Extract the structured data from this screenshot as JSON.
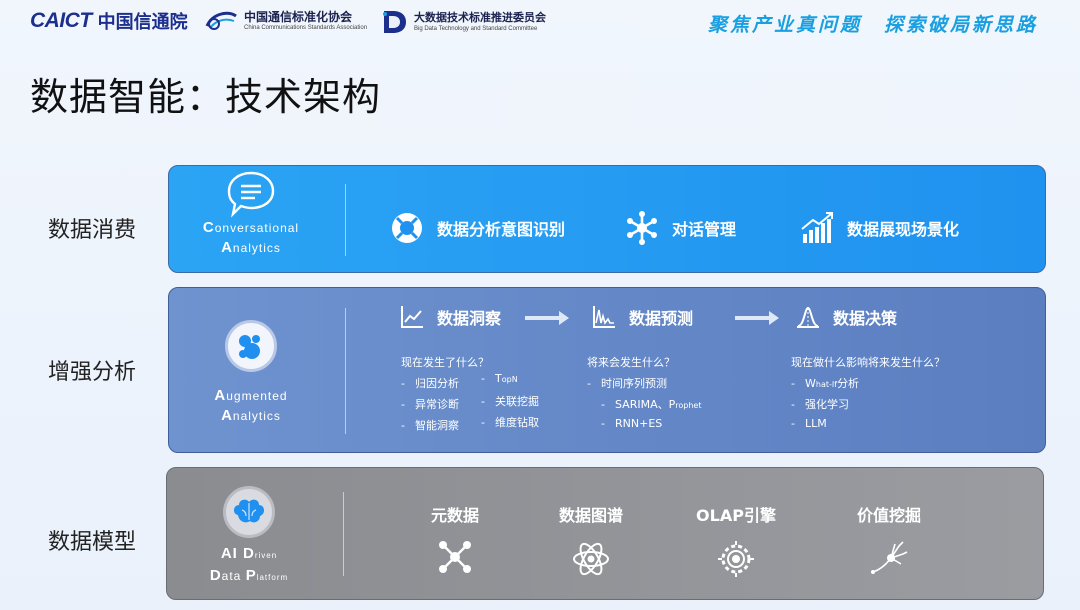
{
  "header": {
    "caict_mark": "CAICT",
    "caict_cn": "中国信通院",
    "ccsa_cn": "中国通信标准化协会",
    "ccsa_en": "China Communications Standards Association",
    "bdtc_cn": "大数据技术标准推进委员会",
    "bdtc_en": "Big Data Technology and Standard Committee",
    "slogan_1": "聚焦产业真问题",
    "slogan_2": "探索破局新思路"
  },
  "title": "数据智能：技术架构",
  "rows": {
    "consume": {
      "label": "数据消费",
      "caption_1_first": "C",
      "caption_1_rest": "onversational",
      "caption_2_first": "A",
      "caption_2_rest": "nalytics",
      "features": [
        {
          "label": "数据分析意图识别",
          "icon": "lifebuoy-icon"
        },
        {
          "label": "对话管理",
          "icon": "network-hub-icon"
        },
        {
          "label": "数据展现场景化",
          "icon": "bar-chart-icon"
        }
      ]
    },
    "augment": {
      "label": "增强分析",
      "caption_1_first": "A",
      "caption_1_rest": "ugmented",
      "caption_2_first": "A",
      "caption_2_rest": "nalytics",
      "stages": [
        {
          "label": "数据洞察",
          "icon": "line-chart-icon"
        },
        {
          "label": "数据预测",
          "icon": "waveform-icon"
        },
        {
          "label": "数据决策",
          "icon": "bell-curve-icon"
        }
      ],
      "insight": {
        "question": "现在发生了什么？",
        "col1": [
          "归因分析",
          "异常诊断",
          "智能洞察"
        ],
        "col2_topn_first": "T",
        "col2_topn_rest": "opN",
        "col2": [
          "关联挖掘",
          "维度钻取"
        ]
      },
      "predict": {
        "question": "将来会发生什么？",
        "item1": "时间序列预测",
        "sub1_main": "SARIMA、P",
        "sub1_small": "rophet",
        "sub2": "RNN+ES"
      },
      "decide": {
        "question": "现在做什么影响将来发生什么？",
        "item1_first": "W",
        "item1_small": "hat-If",
        "item1_rest": "分析",
        "item2": "强化学习",
        "item3": "LLM"
      }
    },
    "model": {
      "label": "数据模型",
      "caption_1": "AI D",
      "caption_1_small": "riven",
      "caption_2_a": "D",
      "caption_2_b": "ata ",
      "caption_2_c": "P",
      "caption_2_d": "latform",
      "items": [
        {
          "label": "元数据",
          "icon": "graph-nodes-icon"
        },
        {
          "label": "数据图谱",
          "icon": "atom-icon"
        },
        {
          "label": "OLAP引擎",
          "icon": "gear-engine-icon"
        },
        {
          "label": "价值挖掘",
          "icon": "neuron-icon"
        }
      ]
    }
  },
  "colors": {
    "consume_panel": "#1f92ef",
    "augment_panel": "#5a7ec0",
    "model_panel": "#9a9ca1",
    "slogan": "#1aa0e0",
    "brand": "#1c2f8c"
  }
}
